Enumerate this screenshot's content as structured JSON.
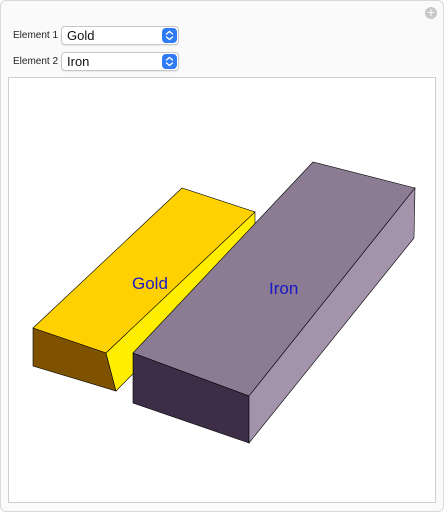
{
  "controls": {
    "element1": {
      "label": "Element 1",
      "value": "Gold"
    },
    "element2": {
      "label": "Element 2",
      "value": "Iron"
    }
  },
  "bars": {
    "left": {
      "label": "Gold",
      "colors": {
        "top": "#ffd100",
        "front": "#7f5200",
        "side": "#ffee00",
        "text": "#1818c8"
      }
    },
    "right": {
      "label": "Iron",
      "colors": {
        "top": "#8b7b93",
        "front": "#3e2d47",
        "side": "#a393ab",
        "text": "#1818c8"
      }
    }
  }
}
